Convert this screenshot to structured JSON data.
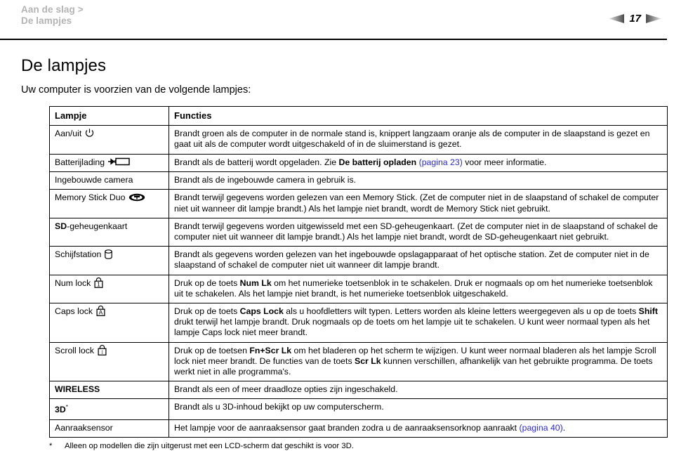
{
  "header": {
    "breadcrumb_line1": "Aan de slag >",
    "breadcrumb_line2": "De lampjes",
    "page_number": "17",
    "prev_icon": "left-arrow-icon",
    "next_icon": "right-arrow-icon"
  },
  "title": "De lampjes",
  "subtitle": "Uw computer is voorzien van de volgende lampjes:",
  "table": {
    "headers": {
      "lamp": "Lampje",
      "function": "Functies"
    },
    "rows": [
      {
        "lamp": "Aan/uit",
        "icon": "power-icon",
        "function_html": "Brandt groen als de computer in de normale stand is, knippert langzaam oranje als de computer in de slaapstand is gezet en gaat uit als de computer wordt uitgeschakeld of in de sluimerstand is gezet."
      },
      {
        "lamp": "Batterijlading",
        "icon": "battery-charge-icon",
        "function_html": "Brandt als de batterij wordt opgeladen. Zie <b>De batterij opladen</b> <span class=\"lnk\">(pagina 23)</span> voor meer informatie."
      },
      {
        "lamp": "Ingebouwde camera",
        "icon": "none",
        "function_html": "Brandt als de ingebouwde camera in gebruik is."
      },
      {
        "lamp": "Memory Stick Duo",
        "icon": "memory-stick-icon",
        "function_html": "Brandt terwijl gegevens worden gelezen van een Memory Stick. (Zet de computer niet in de slaapstand of schakel de computer niet uit wanneer dit lampje brandt.) Als het lampje niet brandt, wordt de Memory Stick niet gebruikt."
      },
      {
        "lamp_html": "<b>SD</b>-geheugenkaart",
        "lamp": "SD-geheugenkaart",
        "icon": "none",
        "function_html": "Brandt terwijl gegevens worden uitgewisseld met een SD-geheugenkaart. (Zet de computer niet in de slaapstand of schakel de computer niet uit wanneer dit lampje brandt.) Als het lampje niet brandt, wordt de SD-geheugenkaart niet gebruikt."
      },
      {
        "lamp": "Schijfstation",
        "icon": "disc-drive-icon",
        "function_html": "Brandt als gegevens worden gelezen van het ingebouwde opslagapparaat of het optische station. Zet de computer niet in de slaapstand of schakel de computer niet uit wanneer dit lampje brandt."
      },
      {
        "lamp": "Num lock",
        "icon": "num-lock-icon",
        "function_html": "Druk op de toets <b>Num Lk</b> om het numerieke toetsenblok in te schakelen. Druk er nogmaals op om het numerieke toetsenblok uit te schakelen. Als het lampje niet brandt, is het numerieke toetsenblok uitgeschakeld."
      },
      {
        "lamp": "Caps lock",
        "icon": "caps-lock-icon",
        "function_html": "Druk op de toets <b>Caps Lock</b> als u hoofdletters wilt typen. Letters worden als kleine letters weergegeven als u op de toets <b>Shift</b> drukt terwijl het lampje brandt. Druk nogmaals op de toets om het lampje uit te schakelen. U kunt weer normaal typen als het lampje Caps lock niet meer brandt."
      },
      {
        "lamp": "Scroll lock",
        "icon": "scroll-lock-icon",
        "function_html": "Druk op de toetsen <b>Fn+Scr Lk</b> om het bladeren op het scherm te wijzigen. U kunt weer normaal bladeren als het lampje Scroll lock niet meer brandt. De functies van de toets <b>Scr Lk</b> kunnen verschillen, afhankelijk van het gebruikte programma. De toets werkt niet in alle programma's."
      },
      {
        "lamp_html": "<b>WIRELESS</b>",
        "lamp": "WIRELESS",
        "icon": "none",
        "function_html": "Brandt als een of meer draadloze opties zijn ingeschakeld."
      },
      {
        "lamp_html": "<b>3D</b><span class=\"sup\">*</span>",
        "lamp": "3D*",
        "icon": "none",
        "function_html": "Brandt als u 3D-inhoud bekijkt op uw computerscherm."
      },
      {
        "lamp": "Aanraaksensor",
        "icon": "none",
        "function_html": "Het lampje voor de aanraaksensor gaat branden zodra u de aanraaksensorknop aanraakt <span class=\"lnk\">(pagina 40)</span>."
      }
    ]
  },
  "footnote": {
    "marker": "*",
    "text": "Alleen op modellen die zijn uitgerust met een LCD-scherm dat geschikt is voor 3D."
  },
  "colors": {
    "breadcrumb": "#b3b3b3",
    "link": "#2b2bd4",
    "rule": "#000000"
  }
}
